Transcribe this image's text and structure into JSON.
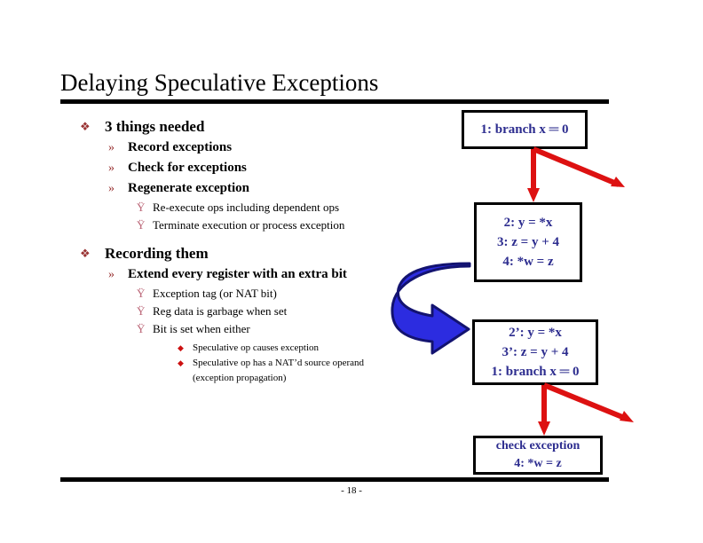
{
  "slide": {
    "title": "Delaying Speculative Exceptions",
    "page_number": "- 18 -"
  },
  "outline": {
    "markers": {
      "level1": "❖",
      "level2": "»",
      "level3": "Ÿ",
      "level4": "◆"
    },
    "items": [
      {
        "level": 1,
        "text": "3 things needed"
      },
      {
        "level": 2,
        "text": "Record exceptions"
      },
      {
        "level": 2,
        "text": "Check for exceptions"
      },
      {
        "level": 2,
        "text": "Regenerate exception"
      },
      {
        "level": 3,
        "text": "Re-execute ops including dependent ops"
      },
      {
        "level": 3,
        "text": "Terminate execution or process exception"
      },
      {
        "level": 1,
        "text": "Recording them"
      },
      {
        "level": 2,
        "text": "Extend every register with an extra bit"
      },
      {
        "level": 3,
        "text": "Exception tag (or NAT bit)"
      },
      {
        "level": 3,
        "text": "Reg data is garbage when set"
      },
      {
        "level": 3,
        "text": "Bit is set when either"
      },
      {
        "level": 4,
        "text": "Speculative op causes exception"
      },
      {
        "level": 4,
        "text": "Speculative op has a NAT’d source operand (exception propagation)"
      }
    ]
  },
  "diagram": {
    "boxes": {
      "branch": {
        "lines": [
          "1: branch x ═ 0"
        ]
      },
      "ops": {
        "lines": [
          "2: y = *x",
          "3: z = y + 4",
          "4: *w = z"
        ]
      },
      "reordered": {
        "lines": [
          "2’: y = *x",
          "3’: z = y + 4",
          "1: branch x ═ 0"
        ]
      },
      "check": {
        "lines": [
          "check exception",
          "4: *w = z"
        ]
      }
    },
    "colors": {
      "box_text": "#2d2d8f",
      "box_border": "#000000",
      "red_arrow": "#dd1111",
      "blue_arrow_fill": "#2c2ce0",
      "blue_arrow_dark": "#1d1d8f",
      "bullet_red": "#993333",
      "rule": "#000000"
    },
    "arrows": [
      {
        "name": "branch-to-ops",
        "type": "straight-down",
        "color": "#dd1111"
      },
      {
        "name": "branch-diagonal",
        "type": "diagonal-down-right",
        "color": "#dd1111"
      },
      {
        "name": "reorder-curve",
        "type": "u-turn-curve",
        "color": "#2c2ce0"
      },
      {
        "name": "reordered-to-check",
        "type": "straight-down",
        "color": "#dd1111"
      },
      {
        "name": "reordered-diagonal",
        "type": "diagonal-down-right",
        "color": "#dd1111"
      }
    ]
  }
}
